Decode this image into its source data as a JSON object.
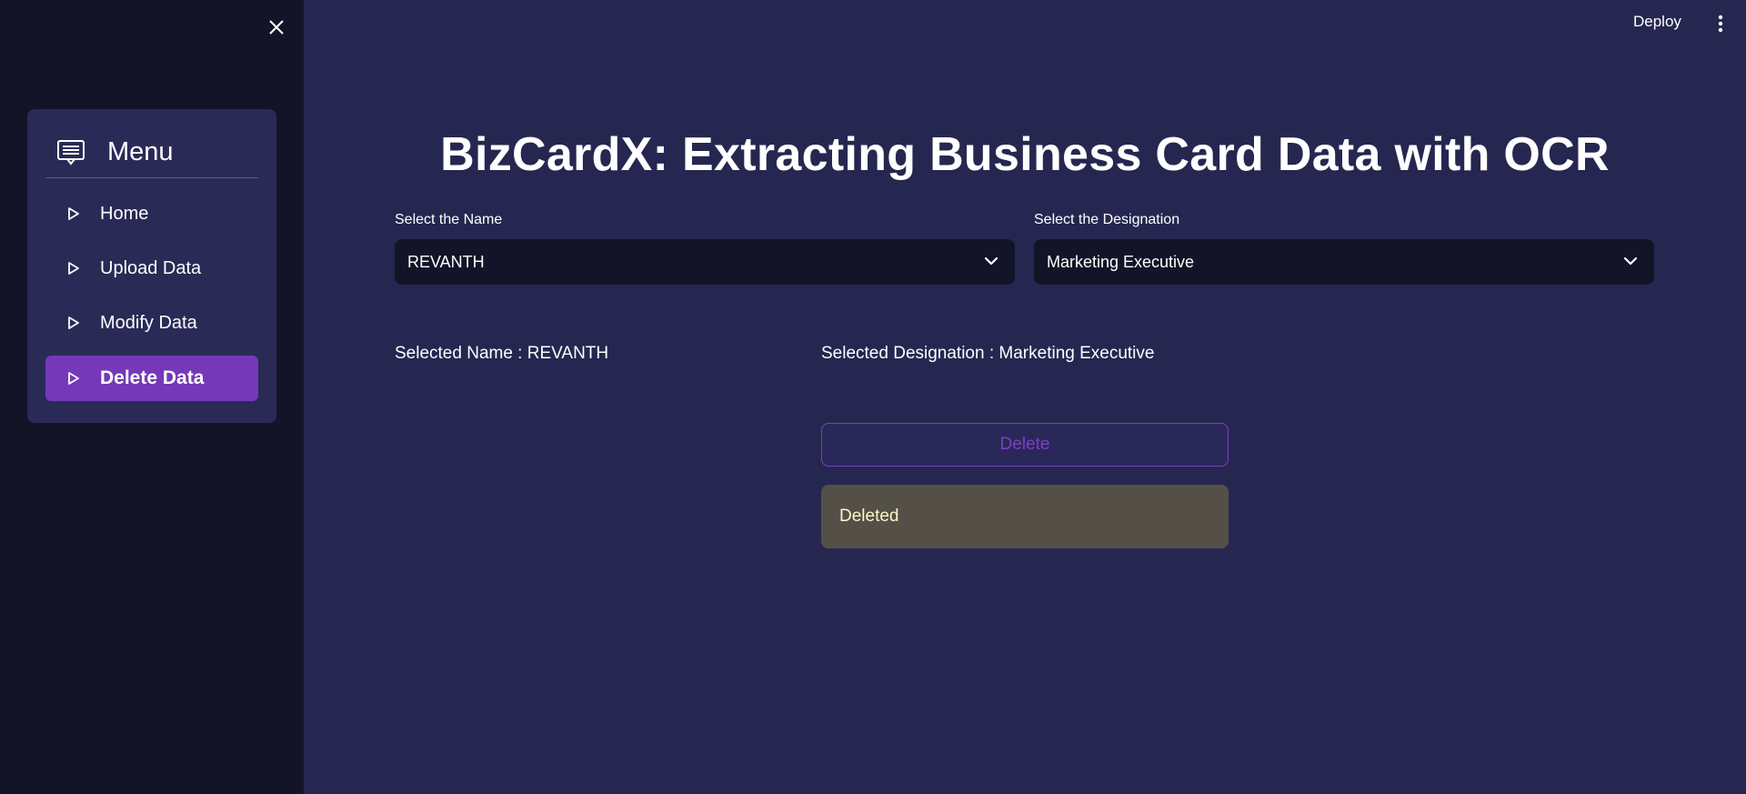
{
  "sidebar": {
    "close_icon": "close-icon",
    "menu": {
      "title": "Menu",
      "icon": "menu-card-icon",
      "items": [
        {
          "label": "Home",
          "active": false
        },
        {
          "label": "Upload Data",
          "active": false
        },
        {
          "label": "Modify Data",
          "active": false
        },
        {
          "label": "Delete Data",
          "active": true
        }
      ]
    }
  },
  "topbar": {
    "deploy_label": "Deploy",
    "more_icon": "more-vertical-icon"
  },
  "main": {
    "title": "BizCardX: Extracting Business Card Data with OCR",
    "name_select": {
      "label": "Select the Name",
      "value": "REVANTH"
    },
    "designation_select": {
      "label": "Select the Designation",
      "value": "Marketing Executive"
    },
    "selected_name_text": "Selected Name : REVANTH",
    "selected_designation_text": "Selected Designation : Marketing Executive",
    "delete_button_label": "Delete",
    "alert_text": "Deleted"
  },
  "colors": {
    "sidebar_bg": "#141428",
    "main_bg": "#262750",
    "accent": "#7538b8",
    "alert_bg": "#545047",
    "alert_text": "#fff6c8"
  }
}
